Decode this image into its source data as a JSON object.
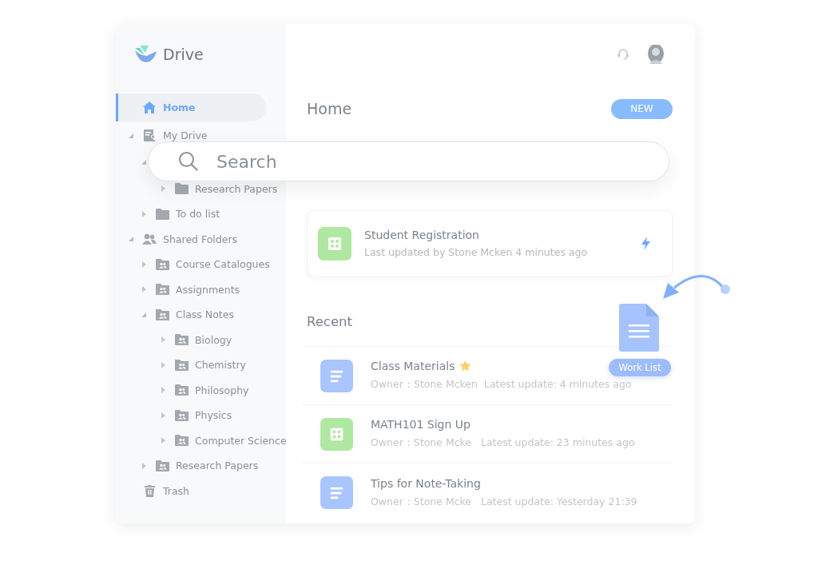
{
  "app": {
    "name": "Drive"
  },
  "sidebar": {
    "items": [
      {
        "label": "Home",
        "kind": "home",
        "selected": true
      },
      {
        "label": "My Drive",
        "kind": "drive",
        "selected": false,
        "expanded": true,
        "children": [
          {
            "expanded": true,
            "children": [
              {
                "label": "Research Papers",
                "kind": "folder",
                "selected": false,
                "expanded": false
              }
            ]
          },
          {
            "label": "To do list",
            "kind": "folder",
            "selected": false,
            "expanded": false
          }
        ]
      },
      {
        "label": "Shared Folders",
        "kind": "shared",
        "selected": false,
        "expanded": true,
        "children": [
          {
            "label": "Course Catalogues",
            "kind": "shared-folder",
            "selected": false,
            "expanded": false
          },
          {
            "label": "Assignments",
            "kind": "shared-folder",
            "selected": false,
            "expanded": false
          },
          {
            "label": "Class Notes",
            "kind": "shared-folder",
            "selected": false,
            "expanded": true,
            "children": [
              {
                "label": "Biology",
                "kind": "shared-folder",
                "selected": false,
                "expanded": false
              },
              {
                "label": "Chemistry",
                "kind": "shared-folder",
                "selected": false,
                "expanded": false
              },
              {
                "label": "Philosophy",
                "kind": "shared-folder",
                "selected": false,
                "expanded": false
              },
              {
                "label": "Physics",
                "kind": "shared-folder",
                "selected": false,
                "expanded": false
              },
              {
                "label": "Computer Science",
                "kind": "shared-folder",
                "selected": false,
                "expanded": false
              }
            ]
          },
          {
            "label": "Research Papers",
            "kind": "shared-folder",
            "selected": false,
            "expanded": false
          }
        ]
      },
      {
        "label": "Trash",
        "kind": "trash",
        "selected": false
      }
    ]
  },
  "main": {
    "title": "Home",
    "new_button": "NEW",
    "search": {
      "placeholder": "Search"
    },
    "quick_access": [
      {
        "name": "Student Registration",
        "subtitle": "Last updated by Stone Mcken 4 minutes ago",
        "kind": "form"
      }
    ],
    "recent": {
      "title": "Recent",
      "files": [
        {
          "name": "Class Materials",
          "kind": "doc",
          "starred": true,
          "owner": "Owner：Stone Mcken",
          "update": "Latest update: 4 minutes ago"
        },
        {
          "name": "MATH101 Sign Up",
          "kind": "form",
          "starred": false,
          "owner": "Owner：Stone Mcke",
          "update": "Latest update: 23 minutes ago"
        },
        {
          "name": "Tips for Note-Taking",
          "kind": "doc",
          "starred": false,
          "owner": "Owner：Stone Mcke",
          "update": "Latest update: Yesterday 21:39"
        }
      ]
    }
  },
  "drag_item": {
    "label": "Work List"
  }
}
